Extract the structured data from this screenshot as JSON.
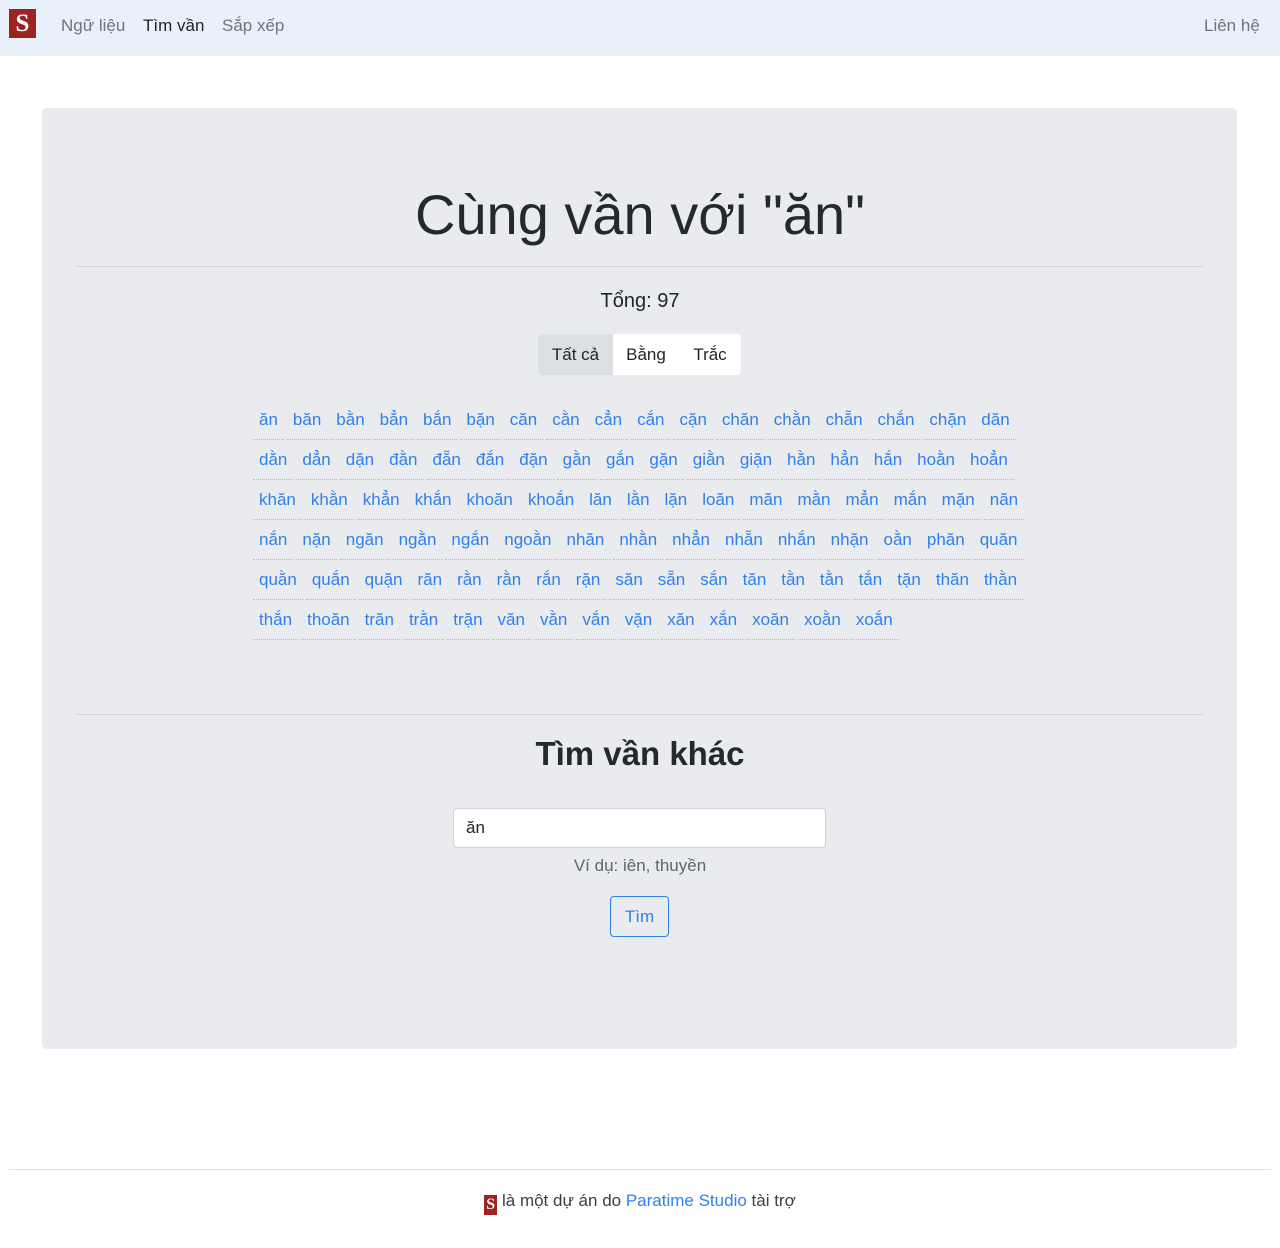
{
  "nav": {
    "logo_letter": "S",
    "items": [
      {
        "label": "Ngữ liệu"
      },
      {
        "label": "Tìm vần"
      },
      {
        "label": "Sắp xếp"
      }
    ],
    "contact": "Liên hệ"
  },
  "main": {
    "title": "Cùng vần với \"ăn\"",
    "total": "Tổng: 97",
    "filters": [
      "Tất cả",
      "Bằng",
      "Trắc"
    ],
    "active_filter": "Tất cả",
    "words": [
      "ăn",
      "băn",
      "bằn",
      "bẳn",
      "bắn",
      "bặn",
      "căn",
      "cằn",
      "cẳn",
      "cắn",
      "cặn",
      "chăn",
      "chằn",
      "chẵn",
      "chắn",
      "chặn",
      "dăn",
      "dằn",
      "dẳn",
      "dặn",
      "đằn",
      "đẵn",
      "đắn",
      "đặn",
      "gằn",
      "gắn",
      "gặn",
      "giằn",
      "giặn",
      "hằn",
      "hẳn",
      "hắn",
      "hoằn",
      "hoẳn",
      "khăn",
      "khằn",
      "khẳn",
      "khắn",
      "khoăn",
      "khoắn",
      "lăn",
      "lằn",
      "lặn",
      "loăn",
      "măn",
      "mằn",
      "mẳn",
      "mắn",
      "mặn",
      "năn",
      "nắn",
      "nặn",
      "ngăn",
      "ngằn",
      "ngắn",
      "ngoằn",
      "nhăn",
      "nhằn",
      "nhẳn",
      "nhẵn",
      "nhắn",
      "nhặn",
      "oằn",
      "phăn",
      "quăn",
      "quằn",
      "quắn",
      "quặn",
      "răn",
      "rằn",
      "rằn",
      "rắn",
      "rặn",
      "săn",
      "sẵn",
      "sắn",
      "tăn",
      "tằn",
      "tằn",
      "tắn",
      "tặn",
      "thăn",
      "thằn",
      "thắn",
      "thoăn",
      "trăn",
      "trằn",
      "trặn",
      "văn",
      "vằn",
      "vắn",
      "vặn",
      "xăn",
      "xắn",
      "xoăn",
      "xoằn",
      "xoắn"
    ],
    "accent_color": "#2f80ed"
  },
  "search": {
    "heading": "Tìm vần khác",
    "value": "ăn",
    "hint": "Ví dụ: iên, thuyền",
    "button_label": "Tìm"
  },
  "footer": {
    "logo_letter": "S",
    "text_before": "là một dự án do",
    "link_text": "Paratime Studio",
    "text_after": "tài trợ"
  },
  "colors": {
    "brand": "#9b2323",
    "navbar_bg": "#e8f0fa",
    "panel_bg": "#e9ebee"
  }
}
